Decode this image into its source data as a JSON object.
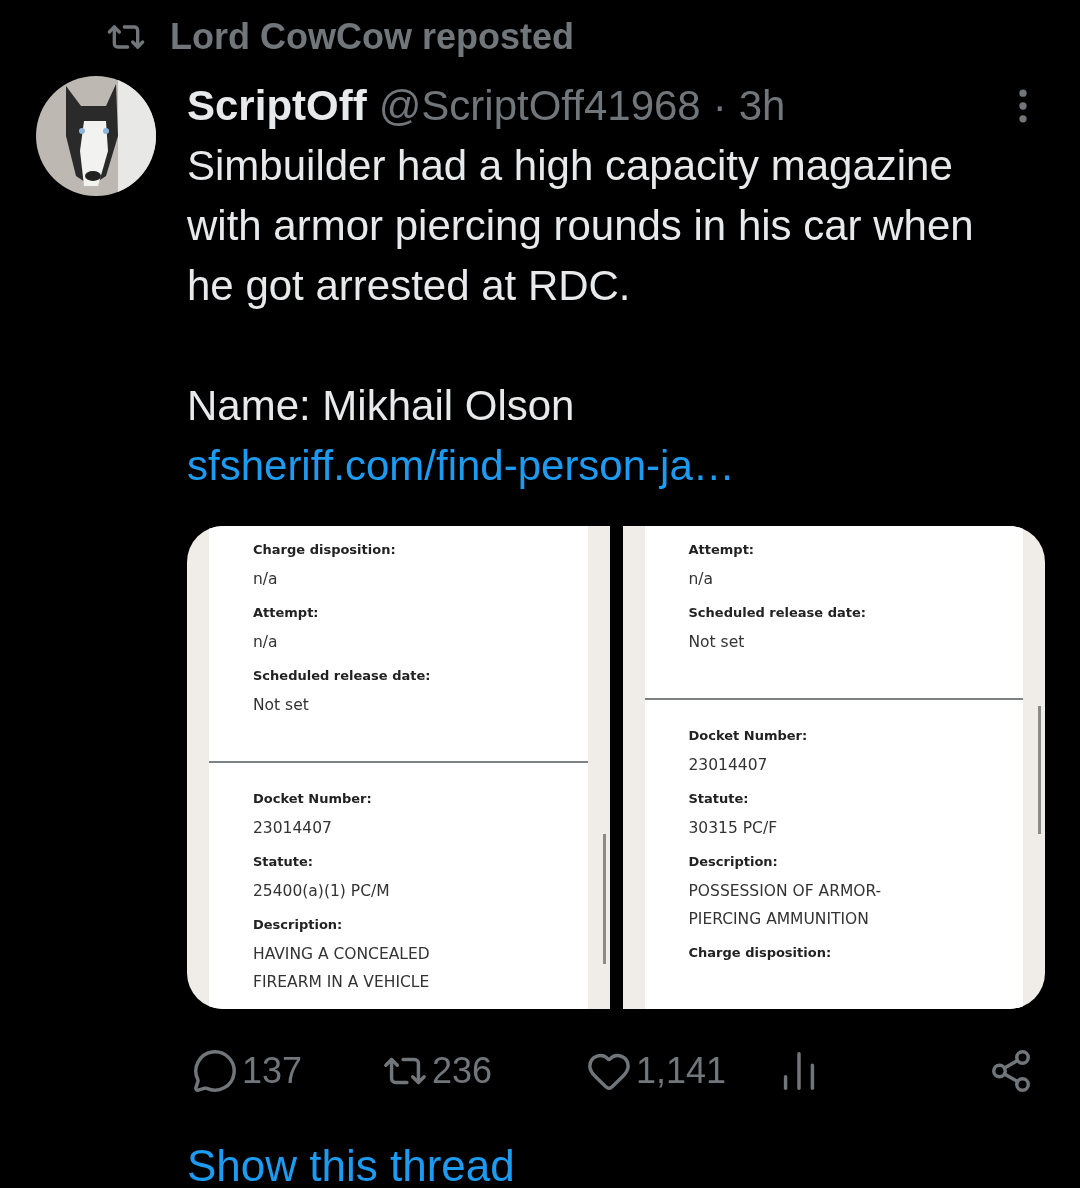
{
  "repost": {
    "label": "Lord CowCow reposted"
  },
  "post": {
    "author": "ScriptOff",
    "handle": "@ScriptOff41968",
    "separator": "·",
    "time": "3h",
    "paragraphs": [
      "Simbuilder had a high capacity magazine with armor piercing rounds in his car when he got arrested at RDC.",
      "Name: Mikhail Olson"
    ],
    "link": "sfsheriff.com/find-person-ja…",
    "images": [
      {
        "groups": [
          [
            {
              "label": "Charge disposition:",
              "value": "n/a"
            },
            {
              "label": "Attempt:",
              "value": "n/a"
            },
            {
              "label": "Scheduled release date:",
              "value": "Not set"
            }
          ],
          [
            {
              "label": "Docket Number:",
              "value": "23014407"
            },
            {
              "label": "Statute:",
              "value": "25400(a)(1) PC/M"
            },
            {
              "label": "Description:",
              "value": "HAVING A CONCEALED FIREARM IN A VEHICLE"
            }
          ]
        ]
      },
      {
        "groups": [
          [
            {
              "label": "Attempt:",
              "value": "n/a"
            },
            {
              "label": "Scheduled release date:",
              "value": "Not set"
            }
          ],
          [
            {
              "label": "Docket Number:",
              "value": "23014407"
            },
            {
              "label": "Statute:",
              "value": "30315 PC/F"
            },
            {
              "label": "Description:",
              "value": "POSSESSION OF ARMOR-PIERCING AMMUNITION"
            },
            {
              "label": "Charge disposition:"
            }
          ]
        ]
      }
    ],
    "actions": [
      {
        "kind": "reply",
        "count": "137"
      },
      {
        "kind": "repost",
        "count": "236"
      },
      {
        "kind": "like",
        "count": "1,141"
      },
      {
        "kind": "views"
      },
      {
        "kind": "share"
      }
    ]
  },
  "thread_link": "Show this thread"
}
